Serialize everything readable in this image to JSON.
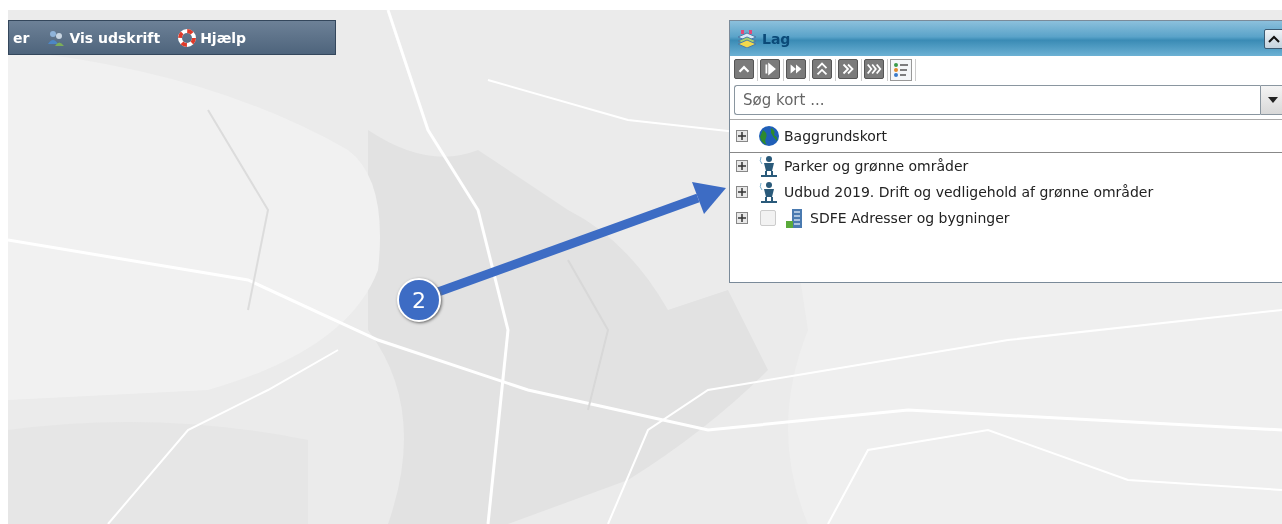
{
  "toolbar": {
    "items": [
      {
        "label": "er"
      },
      {
        "label": "Vis udskrift"
      },
      {
        "label": "Hjælp"
      }
    ]
  },
  "callout": {
    "number": "2"
  },
  "layer_panel": {
    "title": "Lag",
    "search": {
      "placeholder": "Søg kort ..."
    },
    "layers": [
      {
        "label": "Baggrundskort",
        "kind": "group"
      },
      {
        "label": "Parker og grønne områder",
        "kind": "group"
      },
      {
        "label": "Udbud 2019. Drift og vedligehold af grønne områder",
        "kind": "group"
      },
      {
        "label": "SDFE Adresser og bygninger",
        "kind": "checkable",
        "checked": false
      }
    ]
  }
}
